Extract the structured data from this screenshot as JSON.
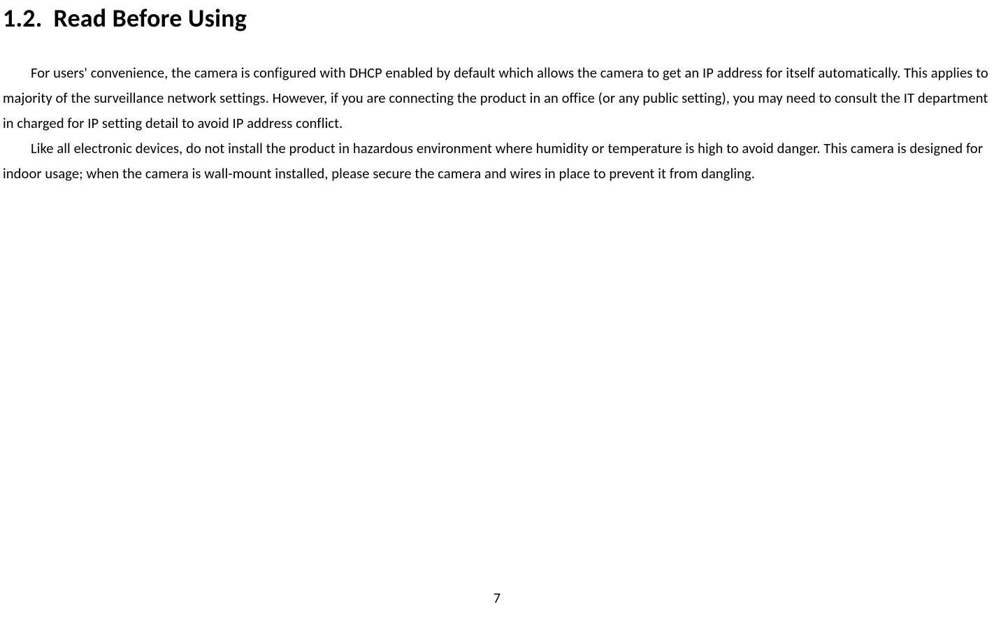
{
  "heading": {
    "number": "1.2.",
    "title": "Read Before Using"
  },
  "paragraphs": {
    "p1": "For users' convenience, the camera is configured with DHCP enabled by default which allows the camera to get an IP address for itself automatically. This applies to majority of the surveillance network settings. However, if you are connecting the product in an office (or any public setting), you may need to consult the IT department in charged for IP setting detail to avoid IP address conflict.",
    "p2": "Like all electronic devices, do not install the product in hazardous environment where humidity or temperature is high to avoid danger. This camera is designed for indoor usage; when the camera is wall-mount installed, please secure the camera and wires in place to prevent it from dangling."
  },
  "page_number": "7"
}
